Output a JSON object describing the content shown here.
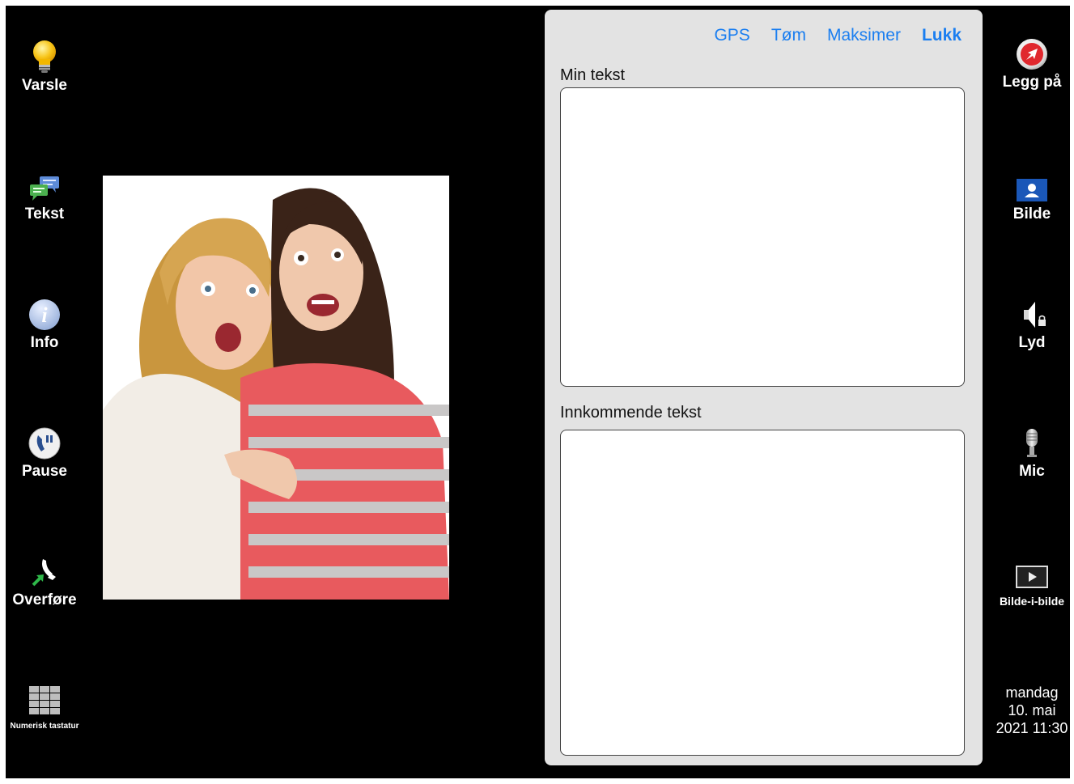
{
  "left_buttons": [
    {
      "label": "Varsle",
      "icon": "lightbulb-icon"
    },
    {
      "label": "Tekst",
      "icon": "chat-bubbles-icon"
    },
    {
      "label": "Info",
      "icon": "info-icon"
    },
    {
      "label": "Pause",
      "icon": "pause-call-icon"
    },
    {
      "label": "Overføre",
      "icon": "transfer-call-icon"
    },
    {
      "label": "Numerisk tastatur",
      "icon": "keypad-icon"
    }
  ],
  "right_buttons": [
    {
      "label": "Legg på",
      "icon": "hang-up-icon"
    },
    {
      "label": "Bilde",
      "icon": "contact-picture-icon"
    },
    {
      "label": "Lyd",
      "icon": "speaker-lock-icon"
    },
    {
      "label": "Mic",
      "icon": "microphone-icon"
    },
    {
      "label": "Bilde-i-bilde",
      "icon": "picture-in-picture-icon"
    }
  ],
  "panel": {
    "actions": [
      "GPS",
      "Tøm",
      "Maksimer",
      "Lukk"
    ],
    "my_text_label": "Min tekst",
    "my_text_value": "",
    "incoming_label": "Innkommende tekst",
    "incoming_value": ""
  },
  "datetime": {
    "day": "mandag",
    "date": "10. mai",
    "year_time": "2021 11:30"
  },
  "colors": {
    "link": "#1a7ef0",
    "panel": "#e3e3e3",
    "background": "#000000"
  }
}
